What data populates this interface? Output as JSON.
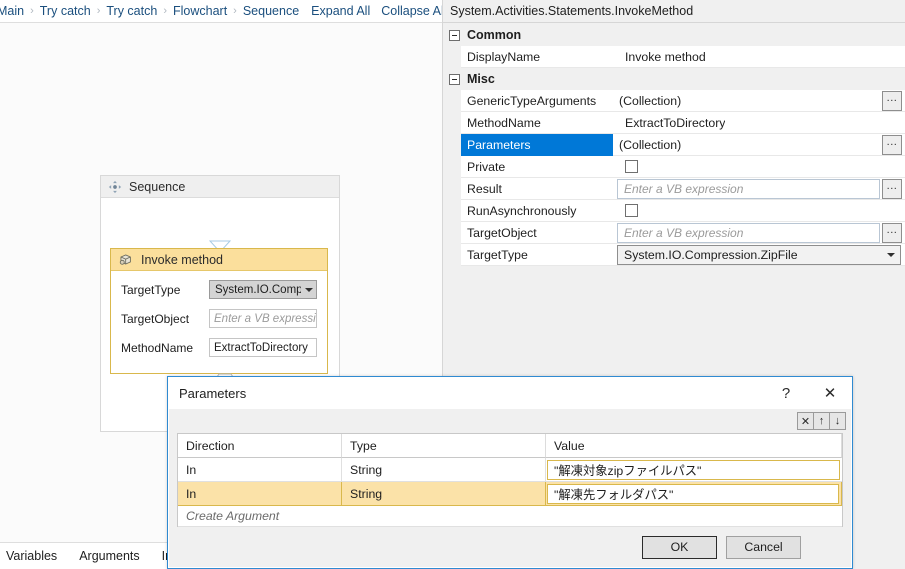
{
  "breadcrumb": {
    "items": [
      "Main",
      "Try catch",
      "Try catch",
      "Flowchart",
      "Sequence"
    ],
    "separator": "›",
    "expand_all": "Expand All",
    "collapse_all": "Collapse All"
  },
  "canvas": {
    "sequence": {
      "title": "Sequence",
      "icon": "move-arrows-icon"
    },
    "invoke_activity": {
      "title": "Invoke method",
      "icon": "cube-icon",
      "fields": [
        {
          "label": "TargetType",
          "value": "System.IO.Compre",
          "kind": "combo"
        },
        {
          "label": "TargetObject",
          "value": "Enter a VB expression",
          "kind": "placeholder"
        },
        {
          "label": "MethodName",
          "value": "ExtractToDirectory",
          "kind": "text"
        }
      ]
    }
  },
  "properties": {
    "type_name": "System.Activities.Statements.InvokeMethod",
    "categories": [
      {
        "name": "Common",
        "rows": [
          {
            "name": "DisplayName",
            "value": "Invoke method",
            "kind": "text",
            "indent": true,
            "selected": false
          }
        ]
      },
      {
        "name": "Misc",
        "rows": [
          {
            "name": "GenericTypeArguments",
            "value": "(Collection)",
            "kind": "collection",
            "selected": false
          },
          {
            "name": "MethodName",
            "value": "ExtractToDirectory",
            "kind": "text",
            "indent": true,
            "selected": false
          },
          {
            "name": "Parameters",
            "value": "(Collection)",
            "kind": "collection",
            "selected": true
          },
          {
            "name": "Private",
            "value": "",
            "kind": "checkbox",
            "checked": false,
            "selected": false
          },
          {
            "name": "Result",
            "value": "Enter a VB expression",
            "kind": "vb",
            "selected": false
          },
          {
            "name": "RunAsynchronously",
            "value": "",
            "kind": "checkbox",
            "checked": false,
            "selected": false
          },
          {
            "name": "TargetObject",
            "value": "Enter a VB expression",
            "kind": "vb",
            "selected": false
          },
          {
            "name": "TargetType",
            "value": "System.IO.Compression.ZipFile",
            "kind": "combo",
            "selected": false
          }
        ]
      }
    ],
    "ellipsis_label": "..."
  },
  "bottom_tabs": [
    "Variables",
    "Arguments",
    "Impo"
  ],
  "dialog": {
    "title": "Parameters",
    "help_label": "?",
    "close_label": "✕",
    "toolbar": [
      {
        "name": "delete-parameter-button",
        "glyph": "✕"
      },
      {
        "name": "move-up-button",
        "glyph": "↑"
      },
      {
        "name": "move-down-button",
        "glyph": "↓"
      }
    ],
    "table": {
      "headers": [
        "Direction",
        "Type",
        "Value"
      ],
      "rows": [
        {
          "direction": "In",
          "type": "String",
          "value": "\"解凍対象zipファイルパス\"",
          "highlight": false
        },
        {
          "direction": "In",
          "type": "String",
          "value": "\"解凍先フォルダパス\"",
          "highlight": true
        }
      ],
      "create_row_label": "Create Argument"
    },
    "ok_label": "OK",
    "cancel_label": "Cancel"
  },
  "colors": {
    "accent_blue": "#0078d7",
    "dialog_border": "#2f8ad1",
    "activity_header": "#fbdf9c",
    "activity_border": "#d9b84c",
    "highlight_row": "#fbe2a8",
    "link_blue": "#1b4f7e"
  }
}
